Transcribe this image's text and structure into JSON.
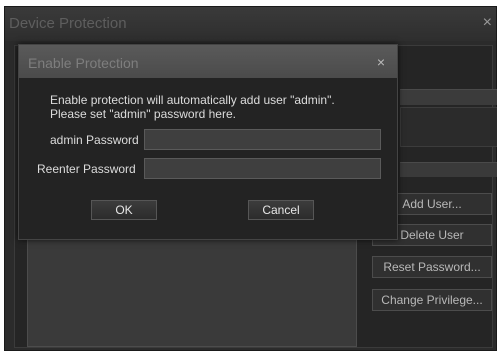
{
  "outer_window": {
    "title": "Device Protection",
    "close_glyph": "×",
    "buttons": {
      "add_user": "Add User...",
      "delete_user": "Delete User",
      "reset_password": "Reset Password...",
      "change_privilege": "Change Privilege..."
    }
  },
  "dialog": {
    "title": "Enable Protection",
    "close_glyph": "×",
    "message_line1": "Enable protection will automatically add user \"admin\".",
    "message_line2": "Please set \"admin\" password here.",
    "admin_password_label": "admin Password",
    "reenter_password_label": "Reenter Password",
    "admin_password_value": "",
    "reenter_password_value": "",
    "ok_label": "OK",
    "cancel_label": "Cancel"
  }
}
